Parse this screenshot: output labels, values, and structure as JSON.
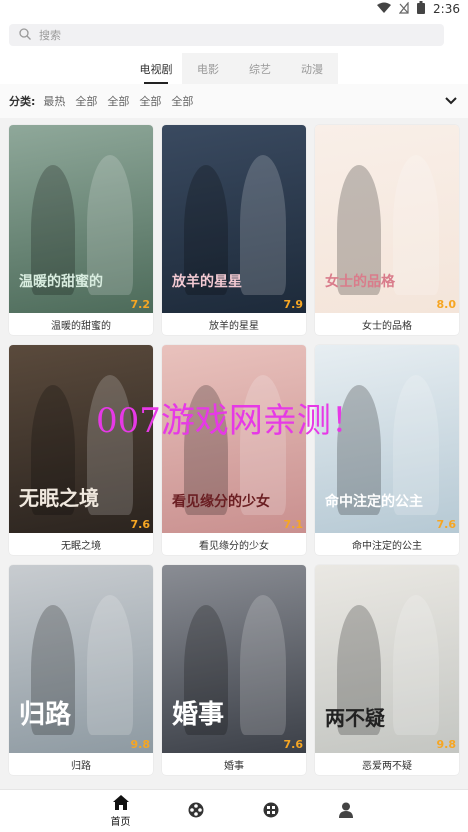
{
  "status": {
    "time": "2:36"
  },
  "search": {
    "placeholder": "搜索"
  },
  "tabs": [
    "电视剧",
    "电影",
    "综艺",
    "动漫"
  ],
  "filter": {
    "label": "分类:",
    "options": [
      "最热",
      "全部",
      "全部",
      "全部",
      "全部"
    ]
  },
  "cards": [
    {
      "name": "温暖的甜蜜的",
      "rating": "7.2",
      "colors": [
        "#4d6b5a",
        "#8fa89a"
      ],
      "poster_text": "温暖的甜蜜的",
      "text_color": "#d8ecdf"
    },
    {
      "name": "放羊的星星",
      "rating": "7.9",
      "colors": [
        "#1d2a3a",
        "#3a4a60"
      ],
      "poster_text": "放羊的星星",
      "text_color": "#f2c9d2"
    },
    {
      "name": "女士的品格",
      "rating": "8.0",
      "colors": [
        "#f4e5da",
        "#f9efe8"
      ],
      "poster_text": "女士的品格",
      "text_color": "#d97c8b"
    },
    {
      "name": "无眠之境",
      "rating": "7.6",
      "colors": [
        "#2b241f",
        "#5a4a3c"
      ],
      "poster_text": "无眠之境",
      "text_color": "#f0e8de"
    },
    {
      "name": "看见缘分的少女",
      "rating": "7.1",
      "colors": [
        "#c9908f",
        "#e9c2bd"
      ],
      "poster_text": "看见缘分的少女",
      "text_color": "#6a1e22"
    },
    {
      "name": "命中注定的公主",
      "rating": "7.6",
      "colors": [
        "#b6c9d4",
        "#e7eef2"
      ],
      "poster_text": "命中注定的公主",
      "text_color": "#ffffff"
    },
    {
      "name": "归路",
      "rating": "9.8",
      "colors": [
        "#8e9aa2",
        "#c8ccd0"
      ],
      "poster_text": "归路",
      "text_color": "#ffffff"
    },
    {
      "name": "婚事",
      "rating": "7.6",
      "colors": [
        "#3c4048",
        "#8a8d94"
      ],
      "poster_text": "婚事",
      "text_color": "#ffffff"
    },
    {
      "name": "恶爱两不疑",
      "rating": "9.8",
      "colors": [
        "#c4c6c2",
        "#eae8e3"
      ],
      "poster_text": "两不疑",
      "text_color": "#222222"
    }
  ],
  "watermark": "007游戏网亲测！",
  "nav": [
    {
      "icon": "home-icon",
      "label": "首页"
    },
    {
      "icon": "film-reel-icon",
      "label": ""
    },
    {
      "icon": "grid-icon",
      "label": ""
    },
    {
      "icon": "user-icon",
      "label": ""
    }
  ]
}
